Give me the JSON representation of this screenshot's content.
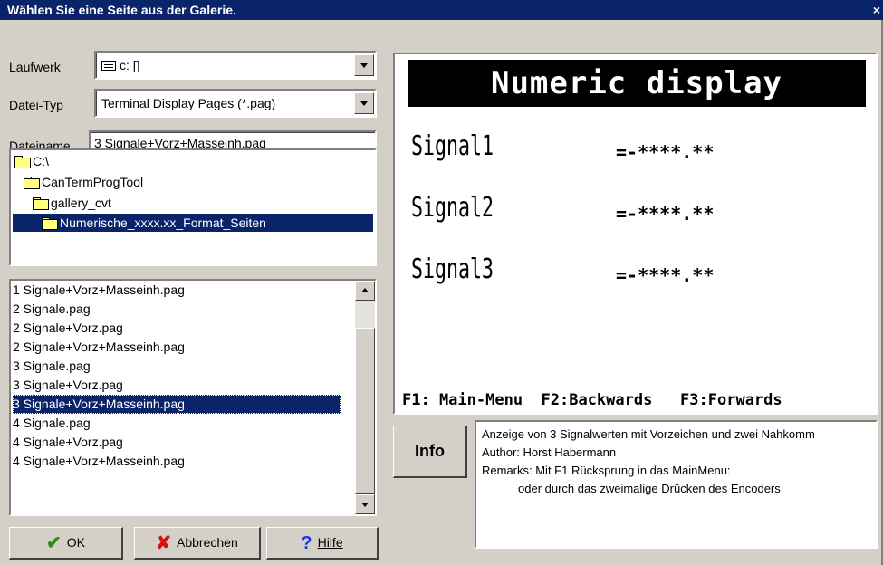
{
  "window": {
    "title": "Wählen Sie eine Seite aus der Galerie.",
    "close_glyph": "×"
  },
  "drive": {
    "label": "Laufwerk",
    "value": "c: []"
  },
  "filetype": {
    "label": "Datei-Typ",
    "value": "Terminal Display Pages  (*.pag)"
  },
  "filename": {
    "label": "Dateiname",
    "value": "3 Signale+Vorz+Masseinh.pag"
  },
  "directories": [
    {
      "label": "C:\\",
      "selected": false
    },
    {
      "label": "CanTermProgTool",
      "selected": false
    },
    {
      "label": "gallery_cvt",
      "selected": false
    },
    {
      "label": "Numerische_xxxx.xx_Format_Seiten",
      "selected": true
    }
  ],
  "files": [
    {
      "label": "1 Signale+Vorz+Masseinh.pag",
      "selected": false
    },
    {
      "label": "2 Signale.pag",
      "selected": false
    },
    {
      "label": "2 Signale+Vorz.pag",
      "selected": false
    },
    {
      "label": "2 Signale+Vorz+Masseinh.pag",
      "selected": false
    },
    {
      "label": "3 Signale.pag",
      "selected": false
    },
    {
      "label": "3 Signale+Vorz.pag",
      "selected": false
    },
    {
      "label": "3 Signale+Vorz+Masseinh.pag",
      "selected": true
    },
    {
      "label": "4 Signale.pag",
      "selected": false
    },
    {
      "label": "4 Signale+Vorz.pag",
      "selected": false
    },
    {
      "label": "4 Signale+Vorz+Masseinh.pag",
      "selected": false
    }
  ],
  "buttons": {
    "ok": "OK",
    "cancel": "Abbrechen",
    "help": "Hilfe",
    "ok_icon": "checkmark-icon",
    "cancel_icon": "cross-icon",
    "help_icon": "question-icon"
  },
  "preview": {
    "title": "Numeric display",
    "signals": [
      {
        "name": "Signal1",
        "value": "=-****.**"
      },
      {
        "name": "Signal2",
        "value": "=-****.**"
      },
      {
        "name": "Signal3",
        "value": "=-****.**"
      }
    ],
    "footer": "F1: Main-Menu  F2:Backwards   F3:Forwards"
  },
  "info": {
    "button_label": "Info",
    "lines": [
      "Anzeige von 3 Signalwerten mit Vorzeichen und zwei Nahkomm",
      "Author: Horst Habermann",
      "Remarks: Mit F1 Rücksprung in das MainMenu:",
      "        oder durch das zweimalige Drücken des Encoders"
    ]
  }
}
